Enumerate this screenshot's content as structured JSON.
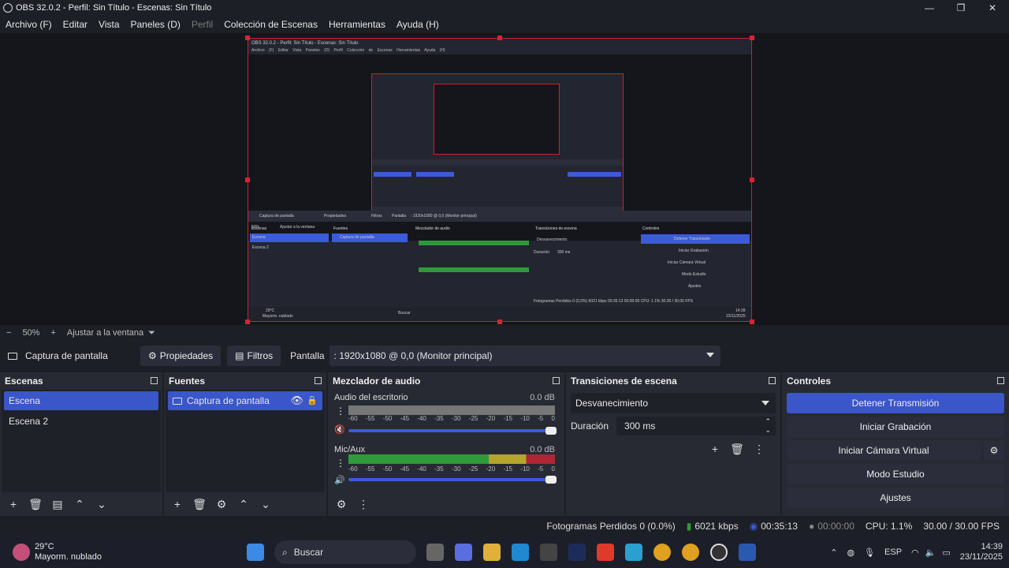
{
  "window": {
    "title": "OBS 32.0.2 - Perfil: Sin Título - Escenas: Sin Título",
    "minimize": "—",
    "maximize": "❐",
    "close": "✕"
  },
  "menu": [
    "Archivo (F)",
    "Editar",
    "Vista",
    "Paneles (D)",
    "Perfil",
    "Colección de Escenas",
    "Herramientas",
    "Ayuda (H)"
  ],
  "mini_preview": {
    "title": "OBS 32.0.2 - Perfil: Sin Título - Escenas: Sin Título",
    "menu": "Archivo (F) Editar Vista Paneles (D) Perfil Colección de Escenas Herramientas Ayuda (H)",
    "zoom": "50%",
    "fit": "Ajustar a la ventana",
    "source": "Captura de pantalla",
    "props": "Propiedades",
    "filters": "Filtros",
    "pantalla": "Pantalla",
    "pantalla_value": ": 1920x1080 @ 0,0 (Monitor principal)",
    "escenas": "Escenas",
    "escena": "Escena",
    "escena2": "Escena 2",
    "fuentes": "Fuentes",
    "fuente": "Captura de pantalla",
    "mezclador": "Mezclador de audio",
    "transiciones": "Transiciones de escena",
    "controles": "Controles",
    "detener": "Detener Transmisión",
    "grabacion": "Iniciar Grabación",
    "camara": "Iniciar Cámara Virtual",
    "estudio": "Modo Estudio",
    "ajustes": "Ajustes",
    "desvanecimiento": "Desvanecimiento",
    "duracion": "Duración",
    "duracion_val": "300 ms",
    "status": "Fotogramas Perdidos 0 (0,0%)  6021 kbps  00:35:13  00:00:00  CPU: 1.1%  30.00 / 30.00 FPS",
    "buscar": "Buscar",
    "temp": "29°C",
    "weather": "Mayorm. nublado",
    "time": "14:39",
    "date": "23/11/2025"
  },
  "zoom": {
    "minus": "−",
    "level": "50%",
    "plus": "+",
    "fit_label": "Ajustar a la ventana",
    "fit_caret": "⏷"
  },
  "source_bar": {
    "source_name": "Captura de pantalla",
    "properties": "Propiedades",
    "filters": "Filtros",
    "pantalla_label": "Pantalla",
    "pantalla_value": ": 1920x1080 @ 0,0 (Monitor principal)"
  },
  "scenes": {
    "header": "Escenas",
    "items": [
      "Escena",
      "Escena 2"
    ],
    "selected": "Escena"
  },
  "sources": {
    "header": "Fuentes",
    "items": [
      "Captura de pantalla"
    ]
  },
  "mixer": {
    "header": "Mezclador de audio",
    "tracks": [
      {
        "name": "Audio del escritorio",
        "db": "0.0 dB",
        "muted": true
      },
      {
        "name": "Mic/Aux",
        "db": "0.0 dB",
        "muted": false
      }
    ],
    "scale": [
      "-60",
      "-55",
      "-50",
      "-45",
      "-40",
      "-35",
      "-30",
      "-25",
      "-20",
      "-15",
      "-10",
      "-5",
      "0"
    ]
  },
  "transitions": {
    "header": "Transiciones de escena",
    "selected": "Desvanecimiento",
    "duration_label": "Duración",
    "duration_value": "300 ms"
  },
  "controls": {
    "header": "Controles",
    "stop_stream": "Detener Transmisión",
    "start_recording": "Iniciar Grabación",
    "start_virtual_cam": "Iniciar Cámara Virtual",
    "studio_mode": "Modo Estudio",
    "settings": "Ajustes"
  },
  "status": {
    "dropped_frames": "Fotogramas Perdidos 0 (0.0%)",
    "bitrate": "6021 kbps",
    "stream_time": "00:35:13",
    "rec_time": "00:00:00",
    "cpu": "CPU: 1.1%",
    "fps": "30.00 / 30.00 FPS"
  },
  "taskbar": {
    "temperature": "29°C",
    "weather": "Mayorm. nublado",
    "search": "Buscar",
    "lang": "ESP",
    "time": "14:39",
    "date": "23/11/2025"
  },
  "colors": {
    "accent": "#3a56c8",
    "selection_border": "#d21f2a",
    "meter_green": "#2f9a3a",
    "meter_yellow": "#b5a52a",
    "meter_red": "#b02535"
  }
}
